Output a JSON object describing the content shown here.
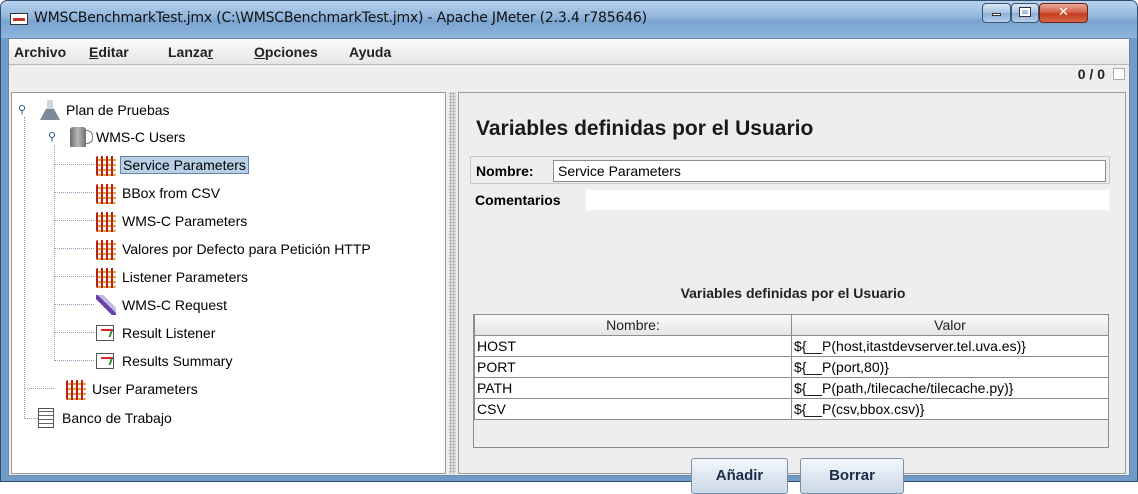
{
  "window": {
    "title": "WMSCBenchmarkTest.jmx (C:\\WMSCBenchmarkTest.jmx) - Apache JMeter (2.3.4 r785646)"
  },
  "menu": {
    "archivo": "Archivo",
    "editar_m": "E",
    "editar_rest": "ditar",
    "lanzar_pre": "Lanza",
    "lanzar_m": "r",
    "opciones_m": "O",
    "opciones_rest": "pciones",
    "ayuda": "Ayuda"
  },
  "status": {
    "counter": "0 / 0"
  },
  "tree": {
    "items": [
      {
        "label": "Plan de Pruebas",
        "icon": "flask-icon"
      },
      {
        "label": "WMS-C Users",
        "icon": "thread-group-icon"
      },
      {
        "label": "Service Parameters",
        "icon": "config-element-icon",
        "selected": true
      },
      {
        "label": "BBox from CSV",
        "icon": "config-element-icon"
      },
      {
        "label": "WMS-C Parameters",
        "icon": "config-element-icon"
      },
      {
        "label": "Valores por Defecto para Petición HTTP",
        "icon": "config-element-icon"
      },
      {
        "label": "Listener Parameters",
        "icon": "config-element-icon"
      },
      {
        "label": "WMS-C Request",
        "icon": "sampler-icon"
      },
      {
        "label": "Result Listener",
        "icon": "listener-icon"
      },
      {
        "label": "Results Summary",
        "icon": "listener-icon"
      },
      {
        "label": "User Parameters",
        "icon": "config-element-icon"
      },
      {
        "label": "Banco de Trabajo",
        "icon": "workbench-icon"
      }
    ]
  },
  "panel": {
    "heading": "Variables definidas por el Usuario",
    "name_label": "Nombre:",
    "name_value": "Service Parameters",
    "comments_label": "Comentarios",
    "comments_value": "",
    "table_title": "Variables definidas por el Usuario",
    "columns": [
      "Nombre:",
      "Valor"
    ],
    "rows": [
      [
        "HOST",
        "${__P(host,itastdevserver.tel.uva.es)}"
      ],
      [
        "PORT",
        "${__P(port,80)}"
      ],
      [
        "PATH",
        "${__P(path,/tilecache/tilecache.py)}"
      ],
      [
        "CSV",
        "${__P(csv,bbox.csv)}"
      ]
    ],
    "add_button": "Añadir",
    "delete_button": "Borrar"
  }
}
